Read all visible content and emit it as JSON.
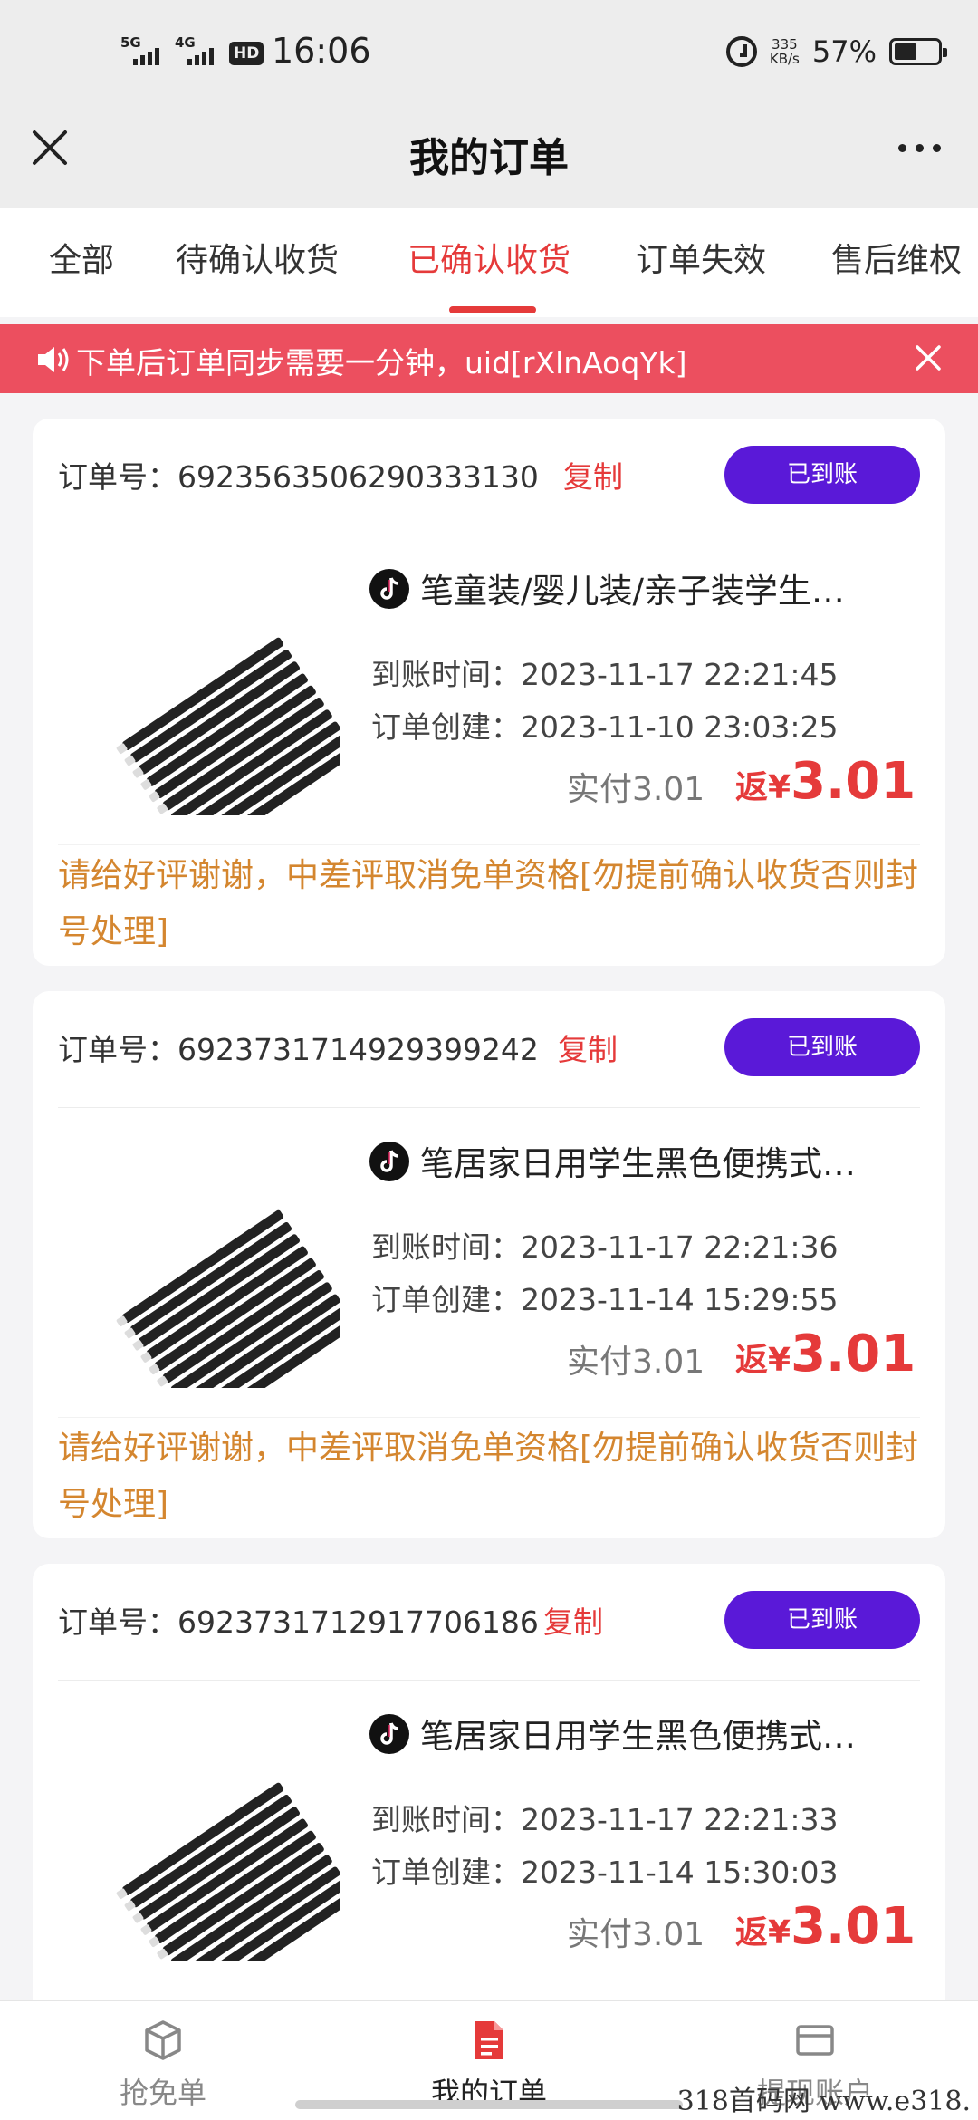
{
  "status_bar": {
    "sig1_label": "5G",
    "sig2_label": "4G",
    "hd_label": "HD",
    "time": "16:06",
    "speed_value": "335",
    "speed_unit": "KB/s",
    "battery": "57%"
  },
  "header": {
    "title": "我的订单"
  },
  "tabs": [
    {
      "label": "全部"
    },
    {
      "label": "待确认收货"
    },
    {
      "label": "已确认收货"
    },
    {
      "label": "订单失效"
    },
    {
      "label": "售后维权"
    }
  ],
  "active_tab": "已确认收货",
  "notice": {
    "text": "下单后订单同步需要一分钟，uid[rXlnAoqYk]"
  },
  "orders": [
    {
      "order_label": "订单号：",
      "order_no": "6923563506290333130",
      "copy_label": "复制",
      "status": "已到账",
      "title": "笔童装/婴儿装/亲子装学生…",
      "arrival_label": "到账时间：",
      "arrival_time": "2023-11-17 22:21:45",
      "created_label": "订单创建：",
      "created_time": "2023-11-10 23:03:25",
      "paid": "实付3.01",
      "cashback_label": "返¥",
      "cashback_amount": "3.01",
      "note": "请给好评谢谢，中差评取消免单资格[勿提前确认收货否则封号处理]"
    },
    {
      "order_label": "订单号：",
      "order_no": "6923731714929399242",
      "copy_label": "复制",
      "status": "已到账",
      "title": "笔居家日用学生黑色便携式…",
      "arrival_label": "到账时间：",
      "arrival_time": "2023-11-17 22:21:36",
      "created_label": "订单创建：",
      "created_time": "2023-11-14 15:29:55",
      "paid": "实付3.01",
      "cashback_label": "返¥",
      "cashback_amount": "3.01",
      "note": "请给好评谢谢，中差评取消免单资格[勿提前确认收货否则封号处理]"
    },
    {
      "order_label": "订单号：",
      "order_no": "6923731712917706186",
      "copy_label": "复制",
      "status": "已到账",
      "title": "笔居家日用学生黑色便携式…",
      "arrival_label": "到账时间：",
      "arrival_time": "2023-11-17 22:21:33",
      "created_label": "订单创建：",
      "created_time": "2023-11-14 15:30:03",
      "paid": "实付3.01",
      "cashback_label": "返¥",
      "cashback_amount": "3.01"
    }
  ],
  "bottom_nav": [
    {
      "label": "抢免单",
      "icon": "box-icon"
    },
    {
      "label": "我的订单",
      "icon": "document-icon"
    },
    {
      "label": "提现账户",
      "icon": "wallet-icon"
    }
  ],
  "watermark": "318首码网 www.e318.",
  "colors": {
    "accent_red": "#e53a3a",
    "notice_bg": "#ec4f5f",
    "status_button": "#5a19d8",
    "note_orange": "#d4862f"
  }
}
